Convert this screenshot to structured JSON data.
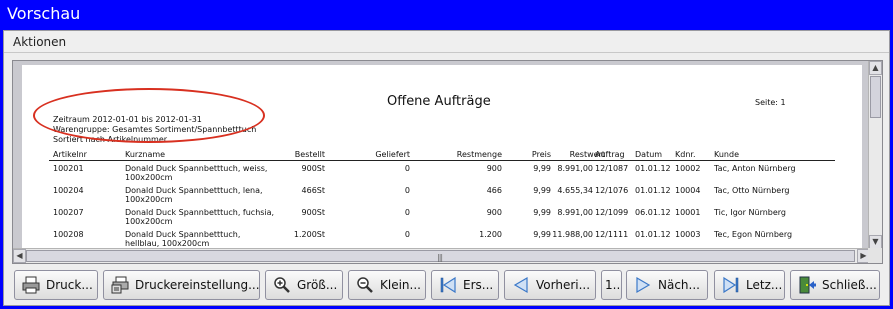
{
  "window": {
    "title": "Vorschau"
  },
  "menu": {
    "actions": "Aktionen"
  },
  "report": {
    "title": "Offene Aufträge",
    "page_label": "Seite: 1",
    "period": "Zeitraum 2012-01-01 bis 2012-01-31",
    "group": "Warengruppe: Gesamtes Sortiment/Spannbetttuch",
    "sort": "Sortiert nach Artikelnummer",
    "columns": {
      "artikelnr": "Artikelnr",
      "kurzname": "Kurzname",
      "bestellt": "Bestellt",
      "geliefert": "Geliefert",
      "restmenge": "Restmenge",
      "preis": "Preis",
      "restwert": "Restwert",
      "auftrag": "Auftrag",
      "datum": "Datum",
      "kdnr": "Kdnr.",
      "kunde": "Kunde"
    },
    "rows": [
      {
        "artikelnr": "100201",
        "kurzname_line1": "Donald Duck Spannbetttuch, weiss,",
        "kurzname_line2": "100x200cm",
        "bestellt": "900St",
        "geliefert": "0",
        "restmenge": "900",
        "preis": "9,99",
        "restwert": "8.991,00",
        "auftrag": "12/1087",
        "datum": "01.01.12",
        "kdnr": "10002",
        "kunde": "Tac, Anton Nürnberg"
      },
      {
        "artikelnr": "100204",
        "kurzname_line1": "Donald Duck Spannbetttuch, lena,",
        "kurzname_line2": "100x200cm",
        "bestellt": "466St",
        "geliefert": "0",
        "restmenge": "466",
        "preis": "9,99",
        "restwert": "4.655,34",
        "auftrag": "12/1076",
        "datum": "01.01.12",
        "kdnr": "10004",
        "kunde": "Tac, Otto Nürnberg"
      },
      {
        "artikelnr": "100207",
        "kurzname_line1": "Donald Duck Spannbetttuch, fuchsia,",
        "kurzname_line2": "100x200cm",
        "bestellt": "900St",
        "geliefert": "0",
        "restmenge": "900",
        "preis": "9,99",
        "restwert": "8.991,00",
        "auftrag": "12/1099",
        "datum": "06.01.12",
        "kdnr": "10001",
        "kunde": "Tic, Igor Nürnberg"
      },
      {
        "artikelnr": "100208",
        "kurzname_line1": "Donald Duck Spannbetttuch,",
        "kurzname_line2": "hellblau, 100x200cm",
        "bestellt": "1.200St",
        "geliefert": "0",
        "restmenge": "1.200",
        "preis": "9,99",
        "restwert": "11.988,00",
        "auftrag": "12/1111",
        "datum": "01.01.12",
        "kdnr": "10003",
        "kunde": "Tec, Egon Nürnberg"
      }
    ]
  },
  "toolbar": {
    "print": "Druck...",
    "printer_settings": "Druckereinstellung...",
    "zoom_in": "Größ...",
    "zoom_out": "Klein...",
    "first": "Ers...",
    "previous": "Vorheri...",
    "page_number": "1...",
    "next": "Näch...",
    "last": "Letz...",
    "close": "Schließ..."
  },
  "colors": {
    "title_bar": "#0000ff",
    "annotation_oval": "#d83020",
    "nav_arrow": "#3b78c8"
  },
  "icons": {
    "print": "printer-icon",
    "printer_settings": "printer-settings-icon",
    "zoom_in": "zoom-in-icon",
    "zoom_out": "zoom-out-icon",
    "first": "first-page-icon",
    "previous": "previous-page-icon",
    "next": "next-page-icon",
    "last": "last-page-icon",
    "close": "close-door-icon"
  }
}
